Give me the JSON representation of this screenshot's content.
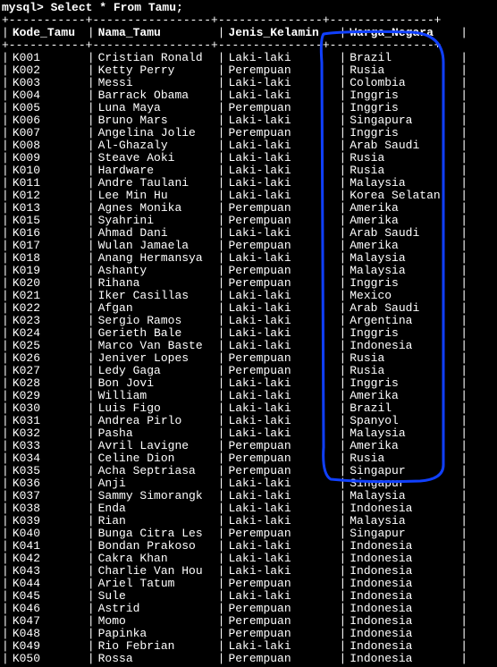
{
  "prompt": "mysql> Select * From Tamu;",
  "columns": {
    "kode": "Kode_Tamu",
    "nama": "Nama_Tamu",
    "jk": "Jenis_Kelamin",
    "wn": "Warga_Negara"
  },
  "annotation_color": "#1040ff",
  "rows": [
    {
      "kode": "K001",
      "nama": "Cristian Ronald",
      "jk": "Laki-laki",
      "wn": "Brazil"
    },
    {
      "kode": "K002",
      "nama": "Ketty Perry",
      "jk": "Perempuan",
      "wn": "Rusia"
    },
    {
      "kode": "K003",
      "nama": "Messi",
      "jk": "Laki-laki",
      "wn": "Colombia"
    },
    {
      "kode": "K004",
      "nama": "Barrack Obama",
      "jk": "Laki-laki",
      "wn": "Inggris"
    },
    {
      "kode": "K005",
      "nama": "Luna Maya",
      "jk": "Perempuan",
      "wn": "Inggris"
    },
    {
      "kode": "K006",
      "nama": "Bruno Mars",
      "jk": "Laki-laki",
      "wn": "Singapura"
    },
    {
      "kode": "K007",
      "nama": "Angelina Jolie",
      "jk": "Perempuan",
      "wn": "Inggris"
    },
    {
      "kode": "K008",
      "nama": "Al-Ghazaly",
      "jk": "Laki-laki",
      "wn": "Arab Saudi"
    },
    {
      "kode": "K009",
      "nama": "Steave Aoki",
      "jk": "Laki-laki",
      "wn": "Rusia"
    },
    {
      "kode": "K010",
      "nama": "Hardware",
      "jk": "Laki-laki",
      "wn": "Rusia"
    },
    {
      "kode": "K011",
      "nama": "Andre Taulani",
      "jk": "Laki-laki",
      "wn": "Malaysia"
    },
    {
      "kode": "K012",
      "nama": "Lee Min Hu",
      "jk": "Laki-laki",
      "wn": "Korea Selatan"
    },
    {
      "kode": "K013",
      "nama": "Agnes Monika",
      "jk": "Perempuan",
      "wn": "Amerika"
    },
    {
      "kode": "K015",
      "nama": "Syahrini",
      "jk": "Perempuan",
      "wn": "Amerika"
    },
    {
      "kode": "K016",
      "nama": "Ahmad Dani",
      "jk": "Laki-laki",
      "wn": "Arab Saudi"
    },
    {
      "kode": "K017",
      "nama": "Wulan Jamaela",
      "jk": "Perempuan",
      "wn": "Amerika"
    },
    {
      "kode": "K018",
      "nama": "Anang Hermansya",
      "jk": "Laki-laki",
      "wn": "Malaysia"
    },
    {
      "kode": "K019",
      "nama": "Ashanty",
      "jk": "Perempuan",
      "wn": "Malaysia"
    },
    {
      "kode": "K020",
      "nama": "Rihana",
      "jk": "Perempuan",
      "wn": "Inggris"
    },
    {
      "kode": "K021",
      "nama": "Iker Casillas",
      "jk": "Laki-laki",
      "wn": "Mexico"
    },
    {
      "kode": "K022",
      "nama": "Afgan",
      "jk": "Laki-laki",
      "wn": "Arab Saudi"
    },
    {
      "kode": "K023",
      "nama": "Sergio Ramos",
      "jk": "Laki-laki",
      "wn": "Argentina"
    },
    {
      "kode": "K024",
      "nama": "Gerieth Bale",
      "jk": "Laki-laki",
      "wn": "Inggris"
    },
    {
      "kode": "K025",
      "nama": "Marco Van Baste",
      "jk": "Laki-laki",
      "wn": "Indonesia"
    },
    {
      "kode": "K026",
      "nama": "Jeniver Lopes",
      "jk": "Perempuan",
      "wn": "Rusia"
    },
    {
      "kode": "K027",
      "nama": "Ledy Gaga",
      "jk": "Perempuan",
      "wn": "Rusia"
    },
    {
      "kode": "K028",
      "nama": "Bon Jovi",
      "jk": "Laki-laki",
      "wn": "Inggris"
    },
    {
      "kode": "K029",
      "nama": "William",
      "jk": "Laki-laki",
      "wn": "Amerika"
    },
    {
      "kode": "K030",
      "nama": "Luis Figo",
      "jk": "Laki-laki",
      "wn": "Brazil"
    },
    {
      "kode": "K031",
      "nama": "Andrea Pirlo",
      "jk": "Laki-laki",
      "wn": "Spanyol"
    },
    {
      "kode": "K032",
      "nama": "Pasha",
      "jk": "Laki-laki",
      "wn": "Malaysia"
    },
    {
      "kode": "K033",
      "nama": "Avril Lavigne",
      "jk": "Perempuan",
      "wn": "Amerika"
    },
    {
      "kode": "K034",
      "nama": "Celine Dion",
      "jk": "Perempuan",
      "wn": "Rusia"
    },
    {
      "kode": "K035",
      "nama": "Acha Septriasa",
      "jk": "Perempuan",
      "wn": "Singapur"
    },
    {
      "kode": "K036",
      "nama": "Anji",
      "jk": "Laki-laki",
      "wn": "Singapur"
    },
    {
      "kode": "K037",
      "nama": "Sammy Simorangk",
      "jk": "Laki-laki",
      "wn": "Malaysia"
    },
    {
      "kode": "K038",
      "nama": "Enda",
      "jk": "Laki-laki",
      "wn": "Indonesia"
    },
    {
      "kode": "K039",
      "nama": "Rian",
      "jk": "Laki-laki",
      "wn": "Malaysia"
    },
    {
      "kode": "K040",
      "nama": "Bunga Citra Les",
      "jk": "Perempuan",
      "wn": "Singapur"
    },
    {
      "kode": "K041",
      "nama": "Bondan Prakoso",
      "jk": "Laki-laki",
      "wn": "Indonesia"
    },
    {
      "kode": "K042",
      "nama": "Cakra Khan",
      "jk": "Laki-laki",
      "wn": "Indonesia"
    },
    {
      "kode": "K043",
      "nama": "Charlie Van Hou",
      "jk": "Laki-laki",
      "wn": "Indonesia"
    },
    {
      "kode": "K044",
      "nama": "Ariel Tatum",
      "jk": "Perempuan",
      "wn": "Indonesia"
    },
    {
      "kode": "K045",
      "nama": "Sule",
      "jk": "Laki-laki",
      "wn": "Indonesia"
    },
    {
      "kode": "K046",
      "nama": "Astrid",
      "jk": "Perempuan",
      "wn": "Indonesia"
    },
    {
      "kode": "K047",
      "nama": "Momo",
      "jk": "Perempuan",
      "wn": "Indonesia"
    },
    {
      "kode": "K048",
      "nama": "Papinka",
      "jk": "Perempuan",
      "wn": "Indonesia"
    },
    {
      "kode": "K049",
      "nama": "Rio Febrian",
      "jk": "Laki-laki",
      "wn": "Indonesia"
    },
    {
      "kode": "K050",
      "nama": "Rossa",
      "jk": "Perempuan",
      "wn": "Indonesia"
    }
  ]
}
